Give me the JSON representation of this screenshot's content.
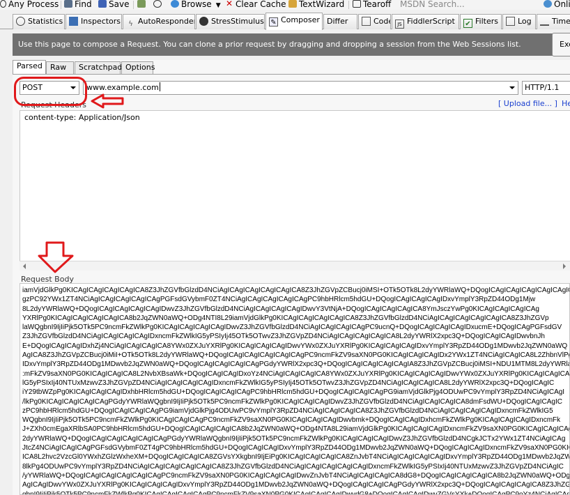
{
  "toolbar": {
    "items": [
      "Any Process",
      "Find",
      "Save",
      "Browse",
      "Clear Cache",
      "TextWizard",
      "Tearoff",
      "MSDN Search...",
      "Onli"
    ]
  },
  "tabs": [
    "Statistics",
    "Inspectors",
    "AutoResponder",
    "StresStimulus",
    "Composer",
    "Differ",
    "Code",
    "FiddlerScript",
    "Filters",
    "Log",
    "Time"
  ],
  "banner": {
    "text": "Use this page to compose a Request. You can clone a prior request by dragging and dropping a session from the Web Sessions list.",
    "execute_label": "Exe"
  },
  "composer": {
    "subtabs": [
      "Parsed",
      "Raw",
      "Scratchpad",
      "Options"
    ],
    "method": "POST",
    "url": "www.example.com",
    "http_version": "HTTP/1.1",
    "headers_label": "Request Headers",
    "upload_link": "[ Upload file... ]",
    "help_link": "He",
    "headers_text": "content-type: Application/Json",
    "body_label": "Request Body",
    "body_lines": [
      "iamVjdGlkPg0KICAgICAgICAgICAgICA8Z3JhZGVfbGlzdD4NCiAgICAgICAgICAgICAgICA8Z3JhZGVpZCBucj0iMSI+OTk5OTk8L2dyYWRlaWQ+DQogICAgICAgICAgICAgICAgIC",
      "gzPC92YWx1ZT4NCiAgICAgICAgICAgICAgPGFsdGVybmF0ZT4NCiAgICAgICAgICAgICAgPC9hbHRlcm5hdGU+DQogICAgICAgICAgIDxvYmplY3RpZD44ODg1Mjw",
      "8L2dyYWRlaWQ+DQogICAgICAgICAgICAgIDwvZ3JhZGVfbGlzdD4NCiAgICAgICAgICAgIDwvY3VtNjA+DQogICAgICAgICAgICA8YmJsczYwPg0KICAgICAgICAgICAg",
      "YXRlPg0KICAgICAgICAgICAgICA8b2JqZWN0aWQ+ODg4NTI8L29iamVjdGlkPg0KICAgICAgICAgICAgICA8Z3JhZGVfbGlzdD4NCiAgICAgICAgICAgICAgICA8Z3JhZGVp",
      "laWQgbnI9IjIiPjk5OTk5PC9ncmFkZWlkPg0KICAgICAgICAgICAgIDwvZ3JhZGVfbGlzdD4NCiAgICAgICAgICAgPC9ucnQ+DQogICAgICAgICAgIDxucmE+DQogICAgPGFsdGV",
      "Z3JhZGVfbGlzdD4NCiAgICAgICAgICAgIDxncmFkZWlkIG5yPSIyIj45OTk5OTwvZ3JhZGVpZD4NCiAgICAgICAgICAgICA8L2dyYWRlX2xpc3Q+DQogICAgICAgIDwvbnJh",
      "E+DQogICAgICAgIDxhZj4NCiAgICAgICAgICA8YWx0ZXJuYXRlPg0KICAgICAgICAgIDwvYWx0ZXJuYXRlPg0KICAgICAgICAgIDxvYmplY3RpZD44ODg1MDwvb2JqZWN0aWQ",
      "AgICA8Z3JhZGVpZCBucj0iMiI+OTk5OTk8L2dyYWRlaWQ+DQogICAgICAgICAgICAgICAgPC9ncmFkZV9saXN0PG0KICAgICAgICAgIDx2YWx1ZT4NCiAgICAgICA8L2ZhbnVlPg",
      "IDxvYmplY3RpZD44ODg1MDwvb2JqZWN0aWQ+DQogICAgICAgICAgICAgPGdyYWRlX2xpc3Q+DQogICAgICAgICAgICAgIA8Z3JhZGVpZCBucj0iMSI+NDU1MTM8L2dyYWRlaWQ",
      ":mFkZV9saXN0PG0KICAgICAgICA8L2NvbXBsaWk+DQogICAgICAgIDxoYz4NCiAgICAgICAgICA8YWx0ZXJuYXRlPg0KICAgICAgICAgIDwvYWx0ZXJuYXRlPg0KICAgICAgICA",
      "lG5yPSIxIj40NTUxMzwvZ3JhZGVpZD4NCiAgICAgICAgICAgIDxncmFkZWlkIG5yPSIyIj45OTk5OTwvZ3JhZGVpZD4NCiAgICAgICAgICA8L2dyYWRlX2xpc3Q+DQogICAgIC",
      "iY29tbWZpPg0KICAgICAgICAgIDxhbHRlcm5hdGU+DQogICAgICAgICAgPC9hbHRlcm5hdGU+DQogICAgICAgICAgPG9iamVjdGlkPjg4ODUwPC9vYmplY3RpZD4NCiAgICAgI",
      "/lkPg0KICAgICAgICAgICAgPGdyYWRlaWQgbnI9IjIiPjk5OTk5PC9ncmFkZWlkPg0KICAgICAgICAgIDwvZ3JhZGVfbGlzdD4NCiAgICAgICAgICA8dmFsdWU+DQogICAgICAgIC",
      "zPC9hbHRlcm5hdGU+DQogICAgICAgICAgPG9iamVjdGlkPjg4ODUwPC9vYmplY3RpZD4NCiAgICAgICAgICA8Z3JhZGVfbGlzdD4NCiAgICAgICAgICAgIDxncmFkZWlkIG5",
      "WQgbnI9IjIiPjk5OTk5PC9ncmFkZWlkPg0KICAgICAgICAgPC9ncmFkZV9saXN0PG0KICAgICAgICAgIDwvbmk+DQogICAgICAgIDxhcmFkZWlkPg0KICAgICAgICAgIDxncmFk",
      "J+ZXh0cmEgaXRlbSA0PC9hbHRlcm5hdGU+DQogICAgICAgICAgICA8b2JqZWN0aWQ+ODg4NTA8L29iamVjdGlkPg0KICAgICAgICAgIDxncmFkZV9saXN0PG0KICAgICAgICAg",
      "2dyYWRlaWQ+DQogICAgICAgICAgICAgICAgPGdyYWRlaWQgbnI9IjIiPjk5OTk5PC9ncmFkZWlkPg0KICAgICAgICAgIDwvZ3JhZGVfbGlzdD4NCgkJCTx2YWx1ZT4NCiAgICAg",
      "JtcZ4NCiAgICAgICAgPGFsdGVybmF0ZT4gPC9hbHRlcm5hdGU+DQogICAgICAgIDxvYmplY3RpZD44ODg1MDwvb2JqZWN0aWQ+DQogICAgICAgIDxncmFkZV9saXN0PG0KICAgIC",
      "ICA8L2hvc2VzcGl0YWxhZGlzWxheXM+DQogICAgICAgICA8ZGVsYXkgbnI9IjEiPg0KICAgICAgICAgICA8ZnJvbT4NCiAgICAgICAgICAgIDxvYmplY3RpZD44ODg1MDwvb2JqZWN0",
      "8lkPg4ODUwPC9vYmplY3RpZD4NCiAgICAgICAgICAgICAgICA8Z3JhZGVfbGlzdD4NCiAgICAgICAgICAgICAgIDxncmFkZWlkIG5yPSIxIj40NTUxMzwvZ3JhZGVpZD4NCiAgIC",
      "/yYWRlaWQ+DQogICAgICAgICAgICAgICAgPC9ncmFkZV9saXN0PG0KICAgICAgICAgIDwvZnJvbT4NCiAgICAgICAgICA8dG8+DQogICAgICAgICAgICA8b2JqZWN0aWQ+ODg4NTA8",
      "AgICAgIDwvYWx0ZXJuYXRlPg0KICAgICAgICAgIDxvYmplY3RpZD44ODg1MDwvb2JqZWN0aWQ+DQogICAgICAgICAgPGdyYWRlX2xpc3Q+DQogICAgICAgICAgICA8Z3JhZGVpZCBu",
      "gbnI9IjIiPjk5OTk5PC9ncmFkZWlkPg0KICAgICAgICAgICAgPC9ncmFkZV9saXN0PG0KICAgICAgICAgIDwvdG8+DQogICAgICAgIDwvZGVsYXk+DQogICAgPC9oYz4NCiAgICAgIA"
    ]
  }
}
